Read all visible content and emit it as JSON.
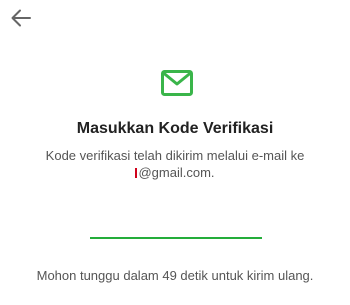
{
  "header": {
    "back_icon": "arrow-left-icon"
  },
  "icon": {
    "name": "mail-icon",
    "color": "#3ab54a"
  },
  "title": "Masukkan Kode Verifikasi",
  "description": {
    "line1": "Kode verifikasi telah dikirim melalui e-mail ke",
    "line2": "@gmail.com."
  },
  "code_input": {
    "value": "",
    "accent_color": "#24ad3a"
  },
  "countdown": {
    "text": "Mohon tunggu dalam 49 detik untuk kirim ulang."
  }
}
